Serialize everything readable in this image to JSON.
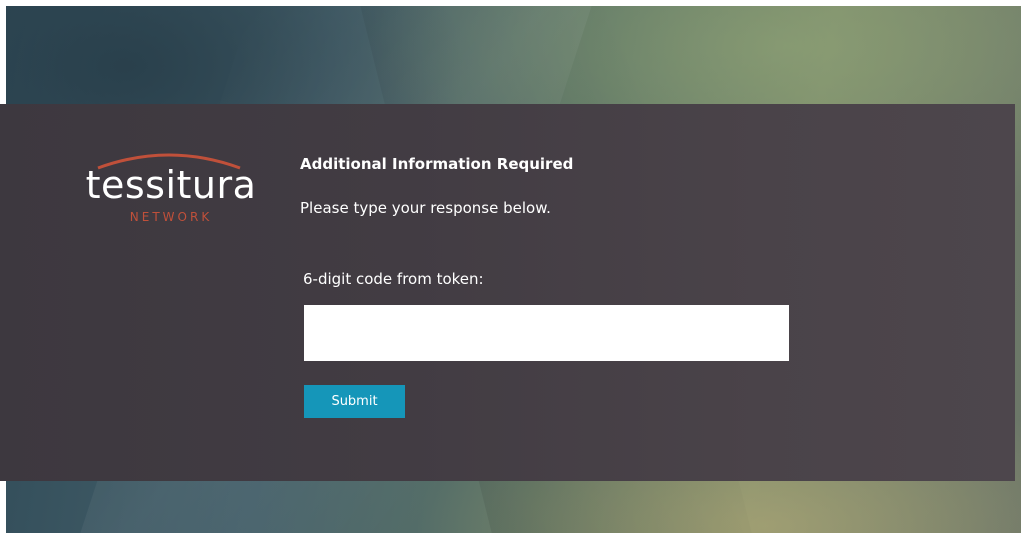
{
  "brand": {
    "name": "tessitura",
    "subtitle": "NETWORK",
    "accent_color": "#c0503a"
  },
  "form": {
    "heading": "Additional Information Required",
    "prompt": "Please type your response below.",
    "field_label": "6-digit code from token:",
    "code_value": "",
    "code_placeholder": "",
    "submit_label": "Submit",
    "button_color": "#1596b9"
  }
}
